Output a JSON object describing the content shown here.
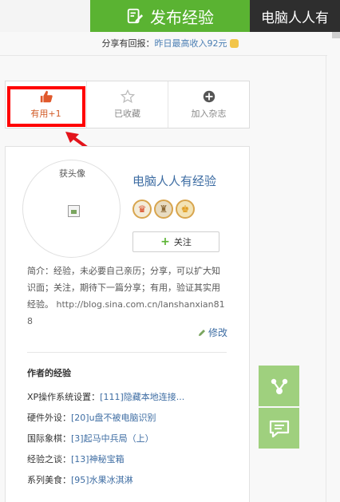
{
  "topbar": {
    "publish_label": "发布经验",
    "brand_tag": "电脑人人有"
  },
  "share_line": {
    "prefix": "分享有回报：",
    "highlight": "昨日最高收入92元"
  },
  "actions": [
    {
      "label": "有用+1",
      "icon": "thumb-up-icon"
    },
    {
      "label": "已收藏",
      "icon": "star-icon"
    },
    {
      "label": "加入杂志",
      "icon": "plus-circle-icon"
    }
  ],
  "author": {
    "avatar_alt": "获头像",
    "name": "电脑人人有经验",
    "badges": [
      "badge-icon-1",
      "badge-icon-2",
      "badge-icon-3"
    ],
    "follow_label": "关注",
    "bio": "简介：经验，未必要自己亲历；分享，可以扩大知识面；关注，期待下一篇分享；有用，验证其实用经验。",
    "bio_url": "http://blog.sina.com.cn/lanshanxian818",
    "edit_label": "修改"
  },
  "works": {
    "title": "作者的经验",
    "items": [
      {
        "category": "XP操作系统设置：",
        "link": "[111]隐藏本地连接..."
      },
      {
        "category": "硬件外设：",
        "link": "[20]u盘不被电脑识别"
      },
      {
        "category": "国际象棋：",
        "link": "[3]起马中兵局（上）"
      },
      {
        "category": "经验之谈：",
        "link": "[13]神秘宝箱"
      },
      {
        "category": "系列美食：",
        "link": "[95]水果冰淇淋"
      }
    ]
  },
  "colors": {
    "accent_green": "#5ab332",
    "link_blue": "#3e6da3",
    "highlight_red": "#ff0000",
    "useful_orange": "#d25b26",
    "side_green": "#9fd07e"
  }
}
